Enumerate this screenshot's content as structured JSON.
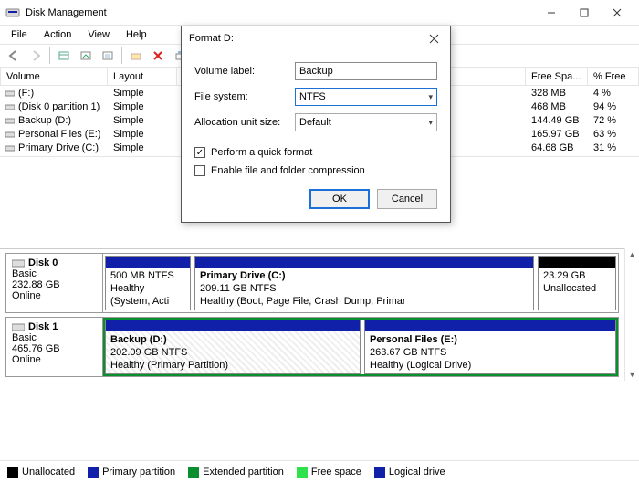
{
  "window": {
    "title": "Disk Management"
  },
  "menubar": {
    "file": "File",
    "action": "Action",
    "view": "View",
    "help": "Help"
  },
  "columns": {
    "volume": "Volume",
    "layout": "Layout",
    "freespace": "Free Spa...",
    "pctfree": "% Free"
  },
  "volumes": [
    {
      "name": "(F:)",
      "layout": "Simple",
      "free": "328 MB",
      "pct": "4 %"
    },
    {
      "name": "(Disk 0 partition 1)",
      "layout": "Simple",
      "free": "468 MB",
      "pct": "94 %"
    },
    {
      "name": "Backup (D:)",
      "layout": "Simple",
      "free": "144.49 GB",
      "pct": "72 %"
    },
    {
      "name": "Personal Files (E:)",
      "layout": "Simple",
      "free": "165.97 GB",
      "pct": "63 %"
    },
    {
      "name": "Primary Drive (C:)",
      "layout": "Simple",
      "free": "64.68 GB",
      "pct": "31 %"
    }
  ],
  "disks": {
    "d0": {
      "title": "Disk 0",
      "type": "Basic",
      "size": "232.88 GB",
      "status": "Online",
      "p0": {
        "line1": "",
        "line2": "500 MB NTFS",
        "line3": "Healthy (System, Acti"
      },
      "p1": {
        "line1": "Primary Drive  (C:)",
        "line2": "209.11 GB NTFS",
        "line3": "Healthy (Boot, Page File, Crash Dump, Primar"
      },
      "p2": {
        "line1": "",
        "line2": "23.29 GB",
        "line3": "Unallocated"
      }
    },
    "d1": {
      "title": "Disk 1",
      "type": "Basic",
      "size": "465.76 GB",
      "status": "Online",
      "p0": {
        "line1": "Backup  (D:)",
        "line2": "202.09 GB NTFS",
        "line3": "Healthy (Primary Partition)"
      },
      "p1": {
        "line1": "Personal Files  (E:)",
        "line2": "263.67 GB NTFS",
        "line3": "Healthy (Logical Drive)"
      }
    }
  },
  "legend": {
    "unalloc": "Unallocated",
    "primary": "Primary partition",
    "ext": "Extended partition",
    "free": "Free space",
    "logical": "Logical drive"
  },
  "dialog": {
    "title": "Format D:",
    "vol_label_lab": "Volume label:",
    "vol_label_val": "Backup",
    "fs_lab": "File system:",
    "fs_val": "NTFS",
    "alloc_lab": "Allocation unit size:",
    "alloc_val": "Default",
    "quick": "Perform a quick format",
    "compress": "Enable file and folder compression",
    "ok": "OK",
    "cancel": "Cancel"
  },
  "colors": {
    "primary": "#1020a8",
    "logical": "#1020a8",
    "ext": "#0a8f2e",
    "free": "#2fe24c",
    "unalloc": "#000000"
  }
}
